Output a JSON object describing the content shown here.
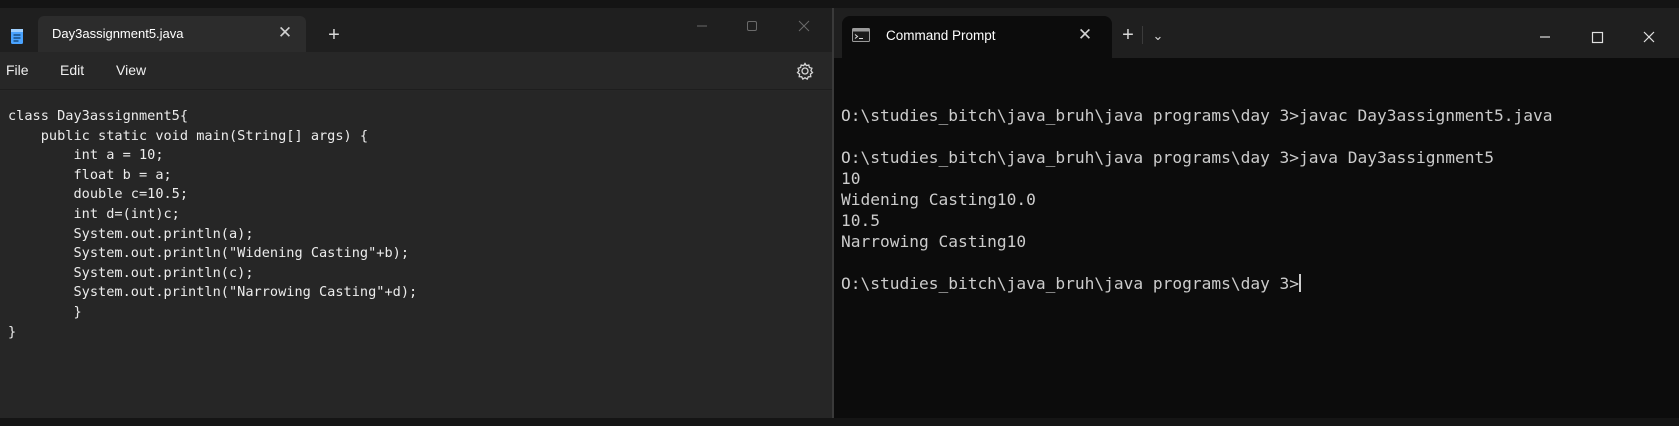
{
  "notepad": {
    "tab_title": "Day3assignment5.java",
    "tab_close_glyph": "✕",
    "new_tab_glyph": "+",
    "menu": {
      "file": "File",
      "edit": "Edit",
      "view": "View"
    },
    "code_lines": [
      "class Day3assignment5{",
      "    public static void main(String[] args) {",
      "        int a = 10;",
      "        float b = a;",
      "        double c=10.5;",
      "        int d=(int)c;",
      "        System.out.println(a);",
      "        System.out.println(\"Widening Casting\"+b);",
      "        System.out.println(c);",
      "        System.out.println(\"Narrowing Casting\"+d);",
      "        }",
      "}"
    ],
    "icons": {
      "app": "notepad-icon",
      "settings": "gear-icon",
      "minimize": "minimize-icon",
      "maximize": "maximize-icon",
      "close": "close-icon"
    }
  },
  "cmd": {
    "tab_title": "Command Prompt",
    "tab_close_glyph": "✕",
    "new_tab_glyph": "+",
    "dropdown_glyph": "⌄",
    "lines": [
      "",
      "O:\\studies_bitch\\java_bruh\\java programs\\day 3>javac Day3assignment5.java",
      "",
      "O:\\studies_bitch\\java_bruh\\java programs\\day 3>java Day3assignment5",
      "10",
      "Widening Casting10.0",
      "10.5",
      "Narrowing Casting10",
      "",
      "O:\\studies_bitch\\java_bruh\\java programs\\day 3>"
    ],
    "icons": {
      "app": "terminal-icon",
      "minimize": "minimize-icon",
      "maximize": "maximize-icon",
      "close": "close-icon"
    }
  },
  "colors": {
    "notepad_background": "#272727",
    "console_background": "#0c0c0c",
    "console_text": "#cccccc",
    "notepad_icon_accent": "#4aa3ff"
  }
}
